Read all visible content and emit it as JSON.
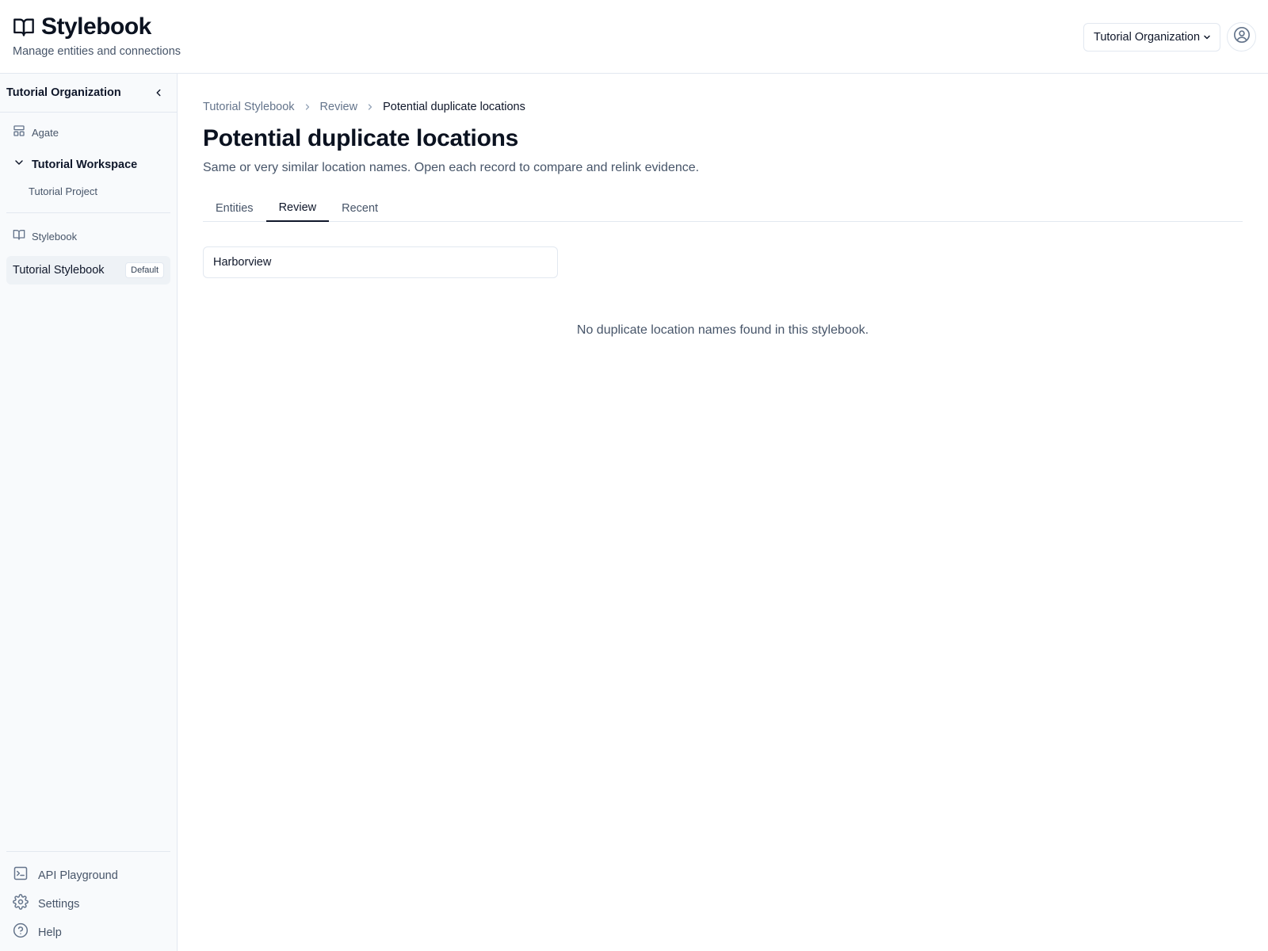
{
  "header": {
    "title": "Stylebook",
    "subtitle": "Manage entities and connections",
    "org_select": {
      "value": "Tutorial Organization",
      "options": [
        "Tutorial Organization"
      ]
    }
  },
  "sidebar": {
    "org_label": "Tutorial Organization",
    "agate_label": "Agate",
    "workspace_label": "Tutorial Workspace",
    "project_label": "Tutorial Project",
    "stylebook_section_label": "Stylebook",
    "active_stylebook": {
      "label": "Tutorial Stylebook",
      "badge": "Default"
    },
    "bottom_items": [
      {
        "label": "API Playground",
        "icon": "terminal-icon"
      },
      {
        "label": "Settings",
        "icon": "gear-icon"
      },
      {
        "label": "Help",
        "icon": "help-circle-icon"
      }
    ]
  },
  "breadcrumb": [
    "Tutorial Stylebook",
    "Review",
    "Potential duplicate locations"
  ],
  "main": {
    "title": "Potential duplicate locations",
    "description": "Same or very similar location names. Open each record to compare and relink evidence.",
    "tabs": [
      {
        "label": "Entities",
        "active": false
      },
      {
        "label": "Review",
        "active": true
      },
      {
        "label": "Recent",
        "active": false
      }
    ],
    "search": {
      "value": "Harborview",
      "placeholder": ""
    },
    "empty_message": "No duplicate location names found in this stylebook."
  }
}
